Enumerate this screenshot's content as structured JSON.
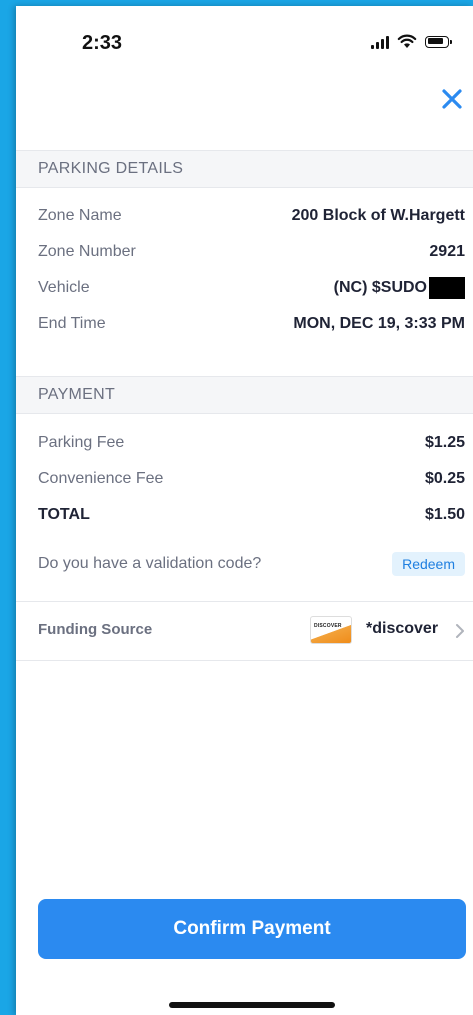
{
  "status_bar": {
    "time": "2:33",
    "icons": [
      "cellular-signal-icon",
      "wifi-icon",
      "battery-icon"
    ]
  },
  "header": {
    "close_icon": "close-icon",
    "accent_color": "#2b8af0"
  },
  "parking_details": {
    "title": "PARKING DETAILS",
    "rows": [
      {
        "label": "Zone Name",
        "value": "200 Block of W.Hargett"
      },
      {
        "label": "Zone Number",
        "value": "2921"
      },
      {
        "label": "Vehicle",
        "value": "(NC) $SUDO"
      },
      {
        "label": "End Time",
        "value": "MON, DEC 19, 3:33 PM"
      }
    ]
  },
  "payment": {
    "title": "PAYMENT",
    "rows": [
      {
        "label": "Parking Fee",
        "value": "$1.25"
      },
      {
        "label": "Convenience Fee",
        "value": "$0.25"
      },
      {
        "label": "TOTAL",
        "value": "$1.50"
      }
    ],
    "validation_question": "Do you have a validation code?",
    "redeem_label": "Redeem"
  },
  "funding": {
    "label": "Funding Source",
    "card_brand": "DISCOVER",
    "card_icon": "discover-card-icon",
    "value": "*discover"
  },
  "footer": {
    "confirm_label": "Confirm Payment"
  }
}
